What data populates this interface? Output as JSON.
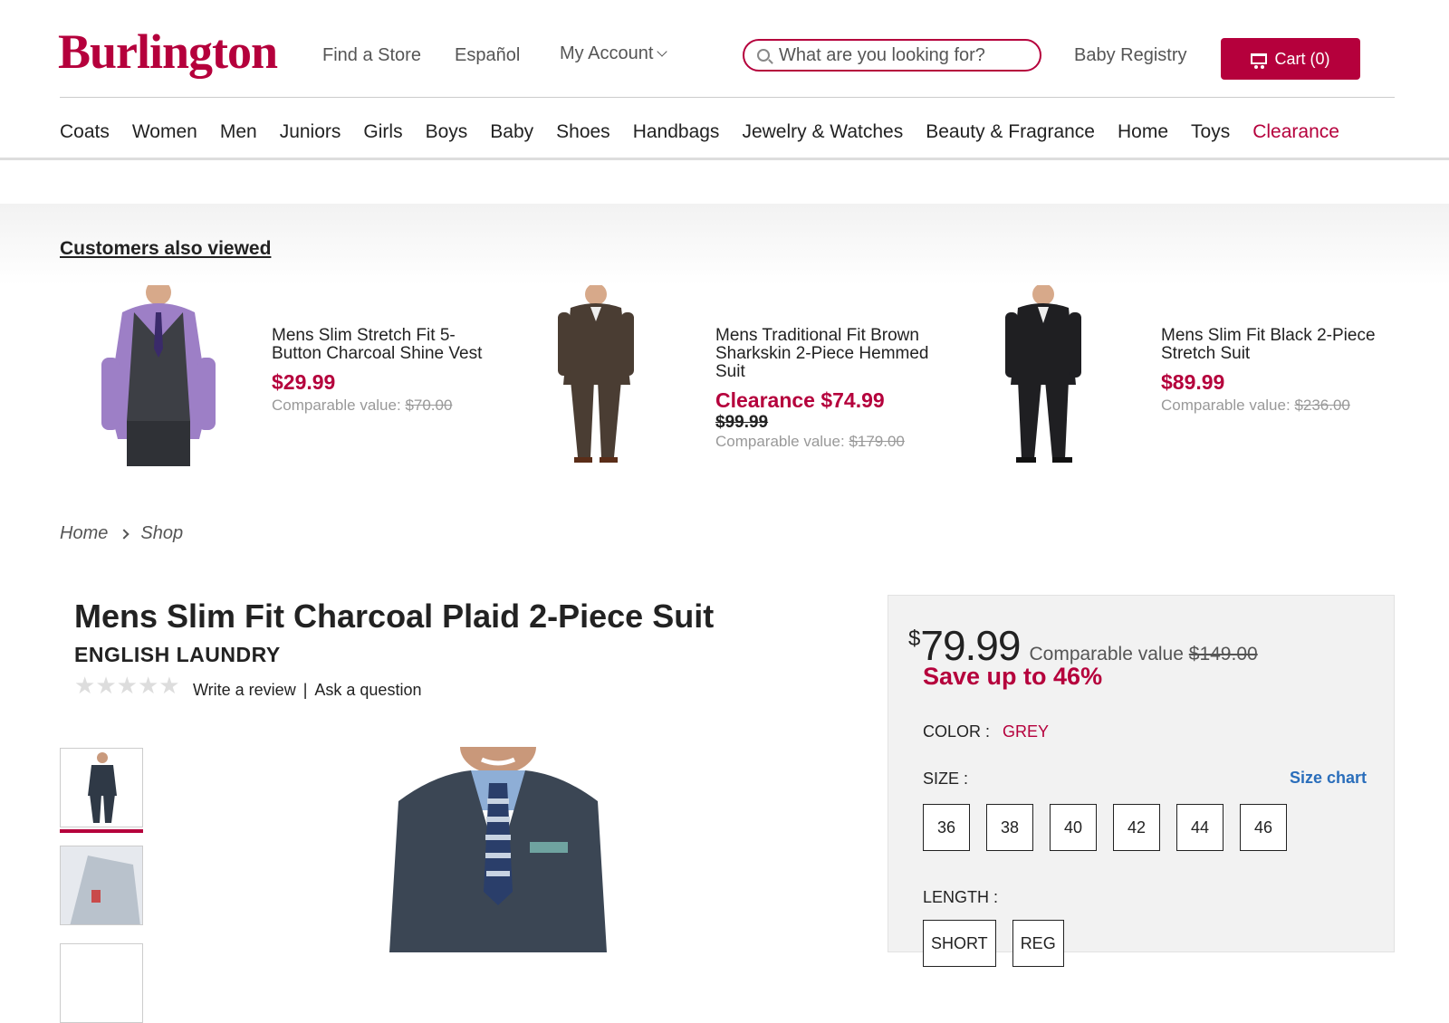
{
  "header": {
    "logo_text": "Burlington",
    "links": [
      "Find a Store",
      "Español",
      "My Account",
      "Baby Registry"
    ],
    "search_placeholder": "What are you looking for?",
    "cart_label": "Cart (0)"
  },
  "nav": [
    "Coats",
    "Women",
    "Men",
    "Juniors",
    "Girls",
    "Boys",
    "Baby",
    "Shoes",
    "Handbags",
    "Jewelry & Watches",
    "Beauty & Fragrance",
    "Home",
    "Toys",
    "Clearance"
  ],
  "also_viewed": {
    "title": "Customers also viewed",
    "items": [
      {
        "name": "Mens Slim Stretch Fit 5-Button Charcoal Shine Vest",
        "price": "$29.99",
        "comparable_label": "Comparable value:",
        "comparable_price": "$70.00"
      },
      {
        "name": "Mens Traditional Fit Brown Sharkskin 2-Piece Hemmed Suit",
        "price": "Clearance $74.99",
        "was_price": "$99.99",
        "comparable_label": "Comparable value:",
        "comparable_price": "$179.00"
      },
      {
        "name": "Mens Slim Fit Black 2-Piece Stretch Suit",
        "price": "$89.99",
        "comparable_label": "Comparable value:",
        "comparable_price": "$236.00"
      }
    ]
  },
  "breadcrumb": [
    "Home",
    "Shop"
  ],
  "product": {
    "title": "Mens Slim Fit Charcoal Plaid 2-Piece Suit",
    "brand": "ENGLISH LAUNDRY",
    "rating_stars": 0,
    "write_review": "Write a review",
    "separator": "|",
    "ask_question": "Ask a question",
    "price_symbol": "$",
    "price": "79.99",
    "comparable_label": "Comparable value",
    "comparable_price": "$149.00",
    "save_text": "Save up to 46%",
    "color_label": "COLOR :",
    "color_value": "GREY",
    "size_label": "SIZE :",
    "size_chart": "Size chart",
    "sizes": [
      "36",
      "38",
      "40",
      "42",
      "44",
      "46"
    ],
    "length_label": "LENGTH :",
    "lengths": [
      "SHORT",
      "REG"
    ]
  },
  "colors": {
    "brand": "#b5003c",
    "link": "#2a6ebb"
  }
}
